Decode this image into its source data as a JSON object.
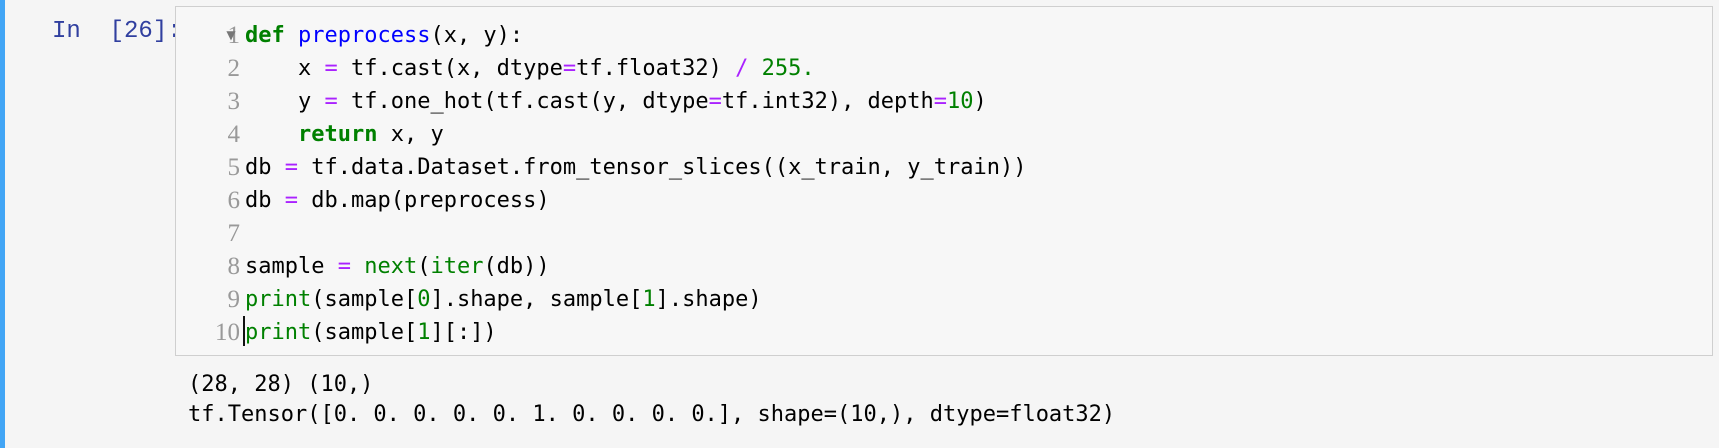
{
  "cell": {
    "prompt": "In  [26]:",
    "accent_color": "#42a5f5",
    "line_numbers": [
      "1",
      "2",
      "3",
      "4",
      "5",
      "6",
      "7",
      "8",
      "9",
      "10"
    ],
    "fold_icon": "fold-arrow-down-icon",
    "code_lines": [
      [
        {
          "text": "def",
          "cls": "kw"
        },
        {
          "text": " ",
          "cls": ""
        },
        {
          "text": "preprocess",
          "cls": "def"
        },
        {
          "text": "(x, y):",
          "cls": ""
        }
      ],
      [
        {
          "text": "    x ",
          "cls": ""
        },
        {
          "text": "=",
          "cls": "op"
        },
        {
          "text": " tf.cast(x, dtype",
          "cls": ""
        },
        {
          "text": "=",
          "cls": "op"
        },
        {
          "text": "tf.float32) ",
          "cls": ""
        },
        {
          "text": "/",
          "cls": "op"
        },
        {
          "text": " ",
          "cls": ""
        },
        {
          "text": "255.",
          "cls": "num"
        }
      ],
      [
        {
          "text": "    y ",
          "cls": ""
        },
        {
          "text": "=",
          "cls": "op"
        },
        {
          "text": " tf.one_hot(tf.cast(y, dtype",
          "cls": ""
        },
        {
          "text": "=",
          "cls": "op"
        },
        {
          "text": "tf.int32), depth",
          "cls": ""
        },
        {
          "text": "=",
          "cls": "op"
        },
        {
          "text": "10",
          "cls": "num"
        },
        {
          "text": ")",
          "cls": ""
        }
      ],
      [
        {
          "text": "    ",
          "cls": ""
        },
        {
          "text": "return",
          "cls": "kw"
        },
        {
          "text": " x, y",
          "cls": ""
        }
      ],
      [
        {
          "text": "db ",
          "cls": ""
        },
        {
          "text": "=",
          "cls": "op"
        },
        {
          "text": " tf.data.Dataset.from_tensor_slices((x_train, y_train))",
          "cls": ""
        }
      ],
      [
        {
          "text": "db ",
          "cls": ""
        },
        {
          "text": "=",
          "cls": "op"
        },
        {
          "text": " db.map(preprocess)",
          "cls": ""
        }
      ],
      [
        {
          "text": "",
          "cls": ""
        }
      ],
      [
        {
          "text": "sample ",
          "cls": ""
        },
        {
          "text": "=",
          "cls": "op"
        },
        {
          "text": " ",
          "cls": ""
        },
        {
          "text": "next",
          "cls": "builtin"
        },
        {
          "text": "(",
          "cls": ""
        },
        {
          "text": "iter",
          "cls": "builtin"
        },
        {
          "text": "(db))",
          "cls": ""
        }
      ],
      [
        {
          "text": "print",
          "cls": "builtin"
        },
        {
          "text": "(sample[",
          "cls": ""
        },
        {
          "text": "0",
          "cls": "num"
        },
        {
          "text": "].shape, sample[",
          "cls": ""
        },
        {
          "text": "1",
          "cls": "num"
        },
        {
          "text": "].shape)",
          "cls": ""
        }
      ],
      [
        {
          "text": "print",
          "cls": "builtin"
        },
        {
          "text": "(sample[",
          "cls": ""
        },
        {
          "text": "1",
          "cls": "num"
        },
        {
          "text": "][:])",
          "cls": ""
        }
      ]
    ]
  },
  "output": {
    "lines": [
      "(28, 28) (10,)",
      "tf.Tensor([0. 0. 0. 0. 0. 1. 0. 0. 0. 0.], shape=(10,), dtype=float32)"
    ]
  }
}
